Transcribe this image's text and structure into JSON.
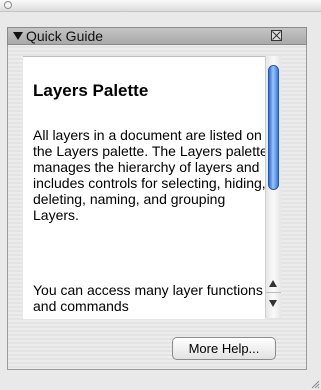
{
  "palette": {
    "title": "Quick Guide",
    "close_icon": "close-box-icon",
    "disclosure_icon": "triangle-down-icon"
  },
  "content": {
    "heading": "Layers Palette",
    "paragraph1": "All layers in a document are listed on the Layers palette. The Layers palette manages the hierarchy of layers and includes controls for selecting, hiding, deleting, naming, and grouping Layers.",
    "paragraph2": "You can access many layer functions and commands"
  },
  "scroll": {
    "position_fraction": 0.0
  },
  "buttons": {
    "more_help": "More Help..."
  },
  "colors": {
    "scroll_thumb": "#3b78df"
  }
}
